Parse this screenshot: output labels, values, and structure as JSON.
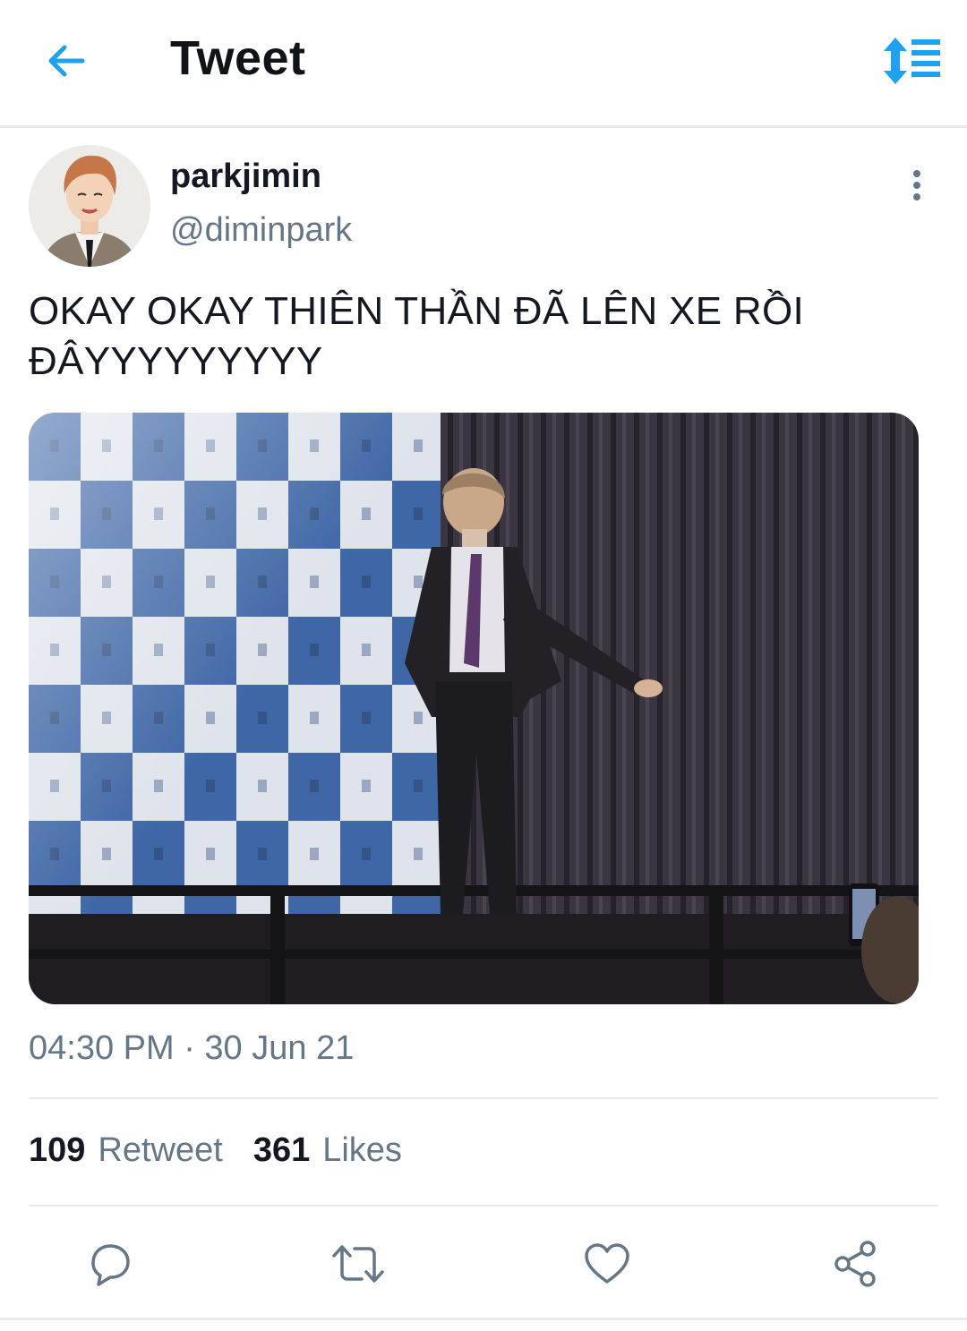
{
  "header": {
    "title": "Tweet",
    "back_icon": "arrow-left-icon",
    "sort_icon": "sort-updown-list-icon",
    "accent": "#1da1f2"
  },
  "tweet": {
    "author": {
      "display_name": "parkjimin",
      "handle": "@diminpark"
    },
    "text": "OKAY OKAY THIÊN THẦN ĐÃ LÊN XE RỒI ĐÂYYYYYYYYY",
    "timestamp": "04:30 PM · 30 Jun 21",
    "stats": {
      "retweets": "109",
      "retweets_label": "Retweet",
      "likes": "361",
      "likes_label": "Likes"
    }
  },
  "actions": [
    {
      "icon": "reply-icon"
    },
    {
      "icon": "retweet-icon"
    },
    {
      "icon": "like-heart-icon"
    },
    {
      "icon": "share-icon"
    }
  ],
  "colors": {
    "secondary_text": "#657786",
    "primary_text": "#141823",
    "divider": "#e6ecf0"
  }
}
